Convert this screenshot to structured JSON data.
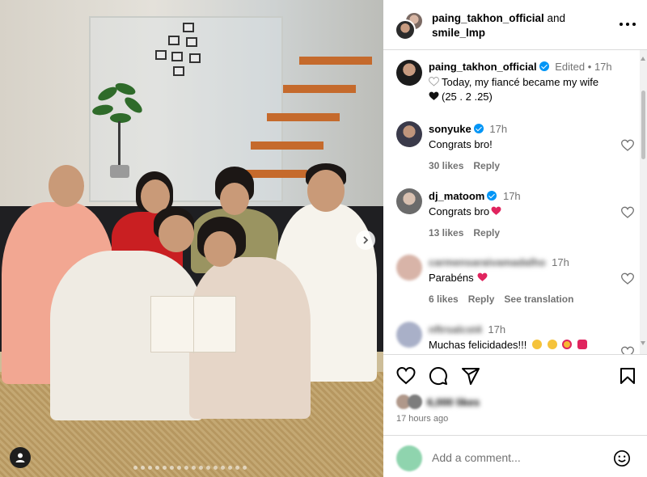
{
  "header": {
    "user1": "paing_takhon_official",
    "connector": " and",
    "user2": "smile_lmp"
  },
  "caption": {
    "username": "paing_takhon_official",
    "edited": "Edited",
    "separator": "•",
    "time": "17h",
    "text_line1": "Today, my fiancé became my wife",
    "text_line2": "(25 . 2 .25)"
  },
  "comments": [
    {
      "username": "sonyuke",
      "time": "17h",
      "text": "Congrats bro!",
      "likes": "30 likes",
      "reply": "Reply"
    },
    {
      "username": "dj_matoom",
      "time": "17h",
      "text": "Congrats bro",
      "likes": "13 likes",
      "reply": "Reply"
    },
    {
      "username": "carmensaraivamadalho",
      "time": "17h",
      "text": "Parabéns",
      "likes": "6 likes",
      "reply": "Reply",
      "translate": "See translation"
    },
    {
      "username": "nftrsalcst4",
      "time": "17h",
      "text": "Muchas felicidades!!!"
    }
  ],
  "actions": {
    "likes_text": "6,000 likes",
    "time_ago": "17 hours ago"
  },
  "comment_box": {
    "placeholder": "Add a comment..."
  },
  "icons": {
    "like": "heart-icon",
    "comment": "comment-icon",
    "share": "share-icon",
    "save": "bookmark-icon",
    "more": "more-icon",
    "emoji": "emoji-icon",
    "next": "chevron-right-icon",
    "tag": "user-tag-icon"
  },
  "colors": {
    "verified": "#0095f6",
    "secondary_text": "#737373",
    "heart_red": "#e0245e"
  }
}
